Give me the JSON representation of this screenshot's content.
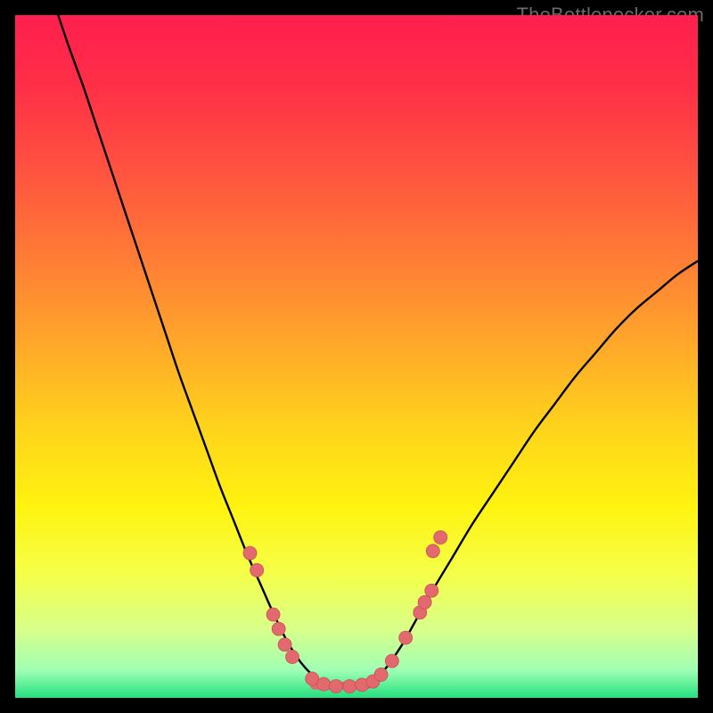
{
  "watermark": "TheBottlenecker.com",
  "colors": {
    "gradient_stops": [
      {
        "offset": 0.0,
        "color": "#ff1f4e"
      },
      {
        "offset": 0.1,
        "color": "#ff2e47"
      },
      {
        "offset": 0.22,
        "color": "#ff5040"
      },
      {
        "offset": 0.35,
        "color": "#ff7a36"
      },
      {
        "offset": 0.48,
        "color": "#ffa72a"
      },
      {
        "offset": 0.6,
        "color": "#ffd21c"
      },
      {
        "offset": 0.72,
        "color": "#fff310"
      },
      {
        "offset": 0.82,
        "color": "#f5ff4a"
      },
      {
        "offset": 0.9,
        "color": "#d8ff8a"
      },
      {
        "offset": 0.96,
        "color": "#9fffb4"
      },
      {
        "offset": 1.0,
        "color": "#24e07e"
      }
    ],
    "curve_stroke": "#000000",
    "marker_fill": "#e26a6f",
    "marker_stroke": "#c95157",
    "floor_line": "#e06a6f"
  },
  "chart_data": {
    "type": "line",
    "title": "",
    "xlabel": "",
    "ylabel": "",
    "xlim": [
      0,
      100
    ],
    "ylim": [
      0,
      100
    ],
    "grid": false,
    "series": [
      {
        "name": "bottleneck-curve",
        "x_pct": [
          6.3,
          8.0,
          10.0,
          12.0,
          14.0,
          16.0,
          18.0,
          20.0,
          22.0,
          24.0,
          26.0,
          28.0,
          30.0,
          32.0,
          34.0,
          36.0,
          38.0,
          40.0,
          42.0,
          44.0,
          46.0,
          48.0,
          50.0,
          52.0,
          54.0,
          56.5,
          58.5,
          61.0,
          64.0,
          67.0,
          70.0,
          73.0,
          76.0,
          79.0,
          82.0,
          85.0,
          88.0,
          91.0,
          94.0,
          97.0,
          100.0
        ],
        "y_pct": [
          100.0,
          95.0,
          89.5,
          83.5,
          77.5,
          71.5,
          65.5,
          59.5,
          53.5,
          47.5,
          42.0,
          36.5,
          31.0,
          26.0,
          21.0,
          16.5,
          12.0,
          8.0,
          5.0,
          3.0,
          2.0,
          2.0,
          2.0,
          2.5,
          4.0,
          7.5,
          11.0,
          15.5,
          20.5,
          25.5,
          30.0,
          34.5,
          39.0,
          43.0,
          47.0,
          50.5,
          54.0,
          57.0,
          59.5,
          62.0,
          64.0
        ]
      }
    ],
    "markers": {
      "name": "sample-points",
      "points": [
        {
          "x_pct": 34.4,
          "y_pct": 21.2
        },
        {
          "x_pct": 35.4,
          "y_pct": 18.7
        },
        {
          "x_pct": 37.8,
          "y_pct": 12.2
        },
        {
          "x_pct": 38.6,
          "y_pct": 10.1
        },
        {
          "x_pct": 39.5,
          "y_pct": 7.8
        },
        {
          "x_pct": 40.6,
          "y_pct": 6.0
        },
        {
          "x_pct": 43.5,
          "y_pct": 2.8
        },
        {
          "x_pct": 45.2,
          "y_pct": 2.0
        },
        {
          "x_pct": 47.0,
          "y_pct": 1.7
        },
        {
          "x_pct": 49.0,
          "y_pct": 1.7
        },
        {
          "x_pct": 50.8,
          "y_pct": 1.9
        },
        {
          "x_pct": 52.4,
          "y_pct": 2.4
        },
        {
          "x_pct": 53.6,
          "y_pct": 3.4
        },
        {
          "x_pct": 55.2,
          "y_pct": 5.4
        },
        {
          "x_pct": 57.2,
          "y_pct": 8.8
        },
        {
          "x_pct": 59.3,
          "y_pct": 12.5
        },
        {
          "x_pct": 60.0,
          "y_pct": 14.0
        },
        {
          "x_pct": 61.0,
          "y_pct": 15.7
        },
        {
          "x_pct": 61.2,
          "y_pct": 21.5
        },
        {
          "x_pct": 62.3,
          "y_pct": 23.5
        }
      ]
    },
    "floor_segment": {
      "x0_pct": 43.8,
      "x1_pct": 51.5,
      "y_pct": 1.8
    }
  }
}
